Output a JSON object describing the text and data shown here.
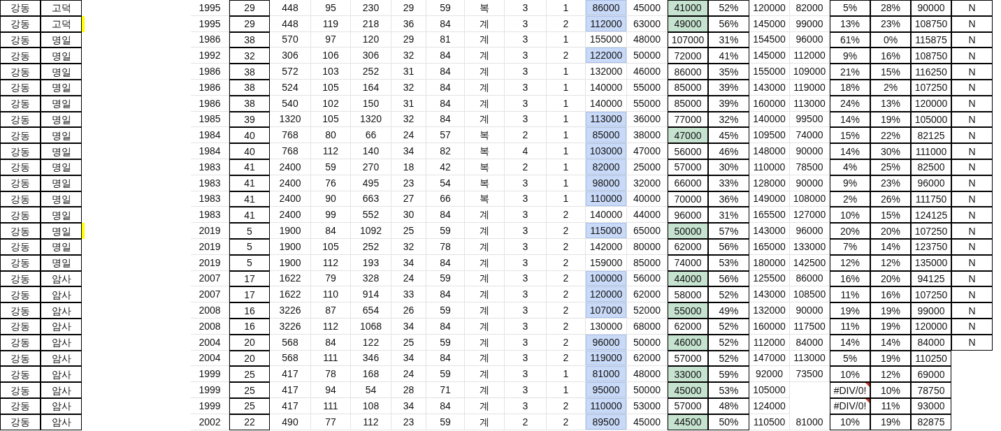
{
  "rows": [
    {
      "cells": [
        "강동",
        "고덕",
        "1995",
        "29",
        "448",
        "95",
        "230",
        "29",
        "59",
        "복",
        "3",
        "1",
        "86000",
        "45000",
        "41000",
        "52%",
        "120000",
        "82000",
        "5%",
        "28%",
        "90000",
        "N"
      ],
      "price_highlight": true,
      "gap_highlight": true,
      "marked": false,
      "error": false
    },
    {
      "cells": [
        "강동",
        "고덕",
        "1995",
        "29",
        "448",
        "119",
        "218",
        "36",
        "84",
        "계",
        "3",
        "2",
        "112000",
        "63000",
        "49000",
        "56%",
        "145000",
        "99000",
        "13%",
        "23%",
        "108750",
        "N"
      ],
      "price_highlight": true,
      "gap_highlight": true,
      "marked": true,
      "error": false
    },
    {
      "cells": [
        "강동",
        "명일",
        "1986",
        "38",
        "570",
        "97",
        "120",
        "29",
        "81",
        "계",
        "3",
        "1",
        "155000",
        "48000",
        "107000",
        "31%",
        "154500",
        "96000",
        "61%",
        "0%",
        "115875",
        "N"
      ],
      "price_highlight": false,
      "gap_highlight": false,
      "marked": false,
      "error": false
    },
    {
      "cells": [
        "강동",
        "명일",
        "1992",
        "32",
        "306",
        "106",
        "306",
        "32",
        "84",
        "계",
        "3",
        "2",
        "122000",
        "50000",
        "72000",
        "41%",
        "145000",
        "112000",
        "9%",
        "16%",
        "108750",
        "N"
      ],
      "price_highlight": true,
      "gap_highlight": false,
      "marked": false,
      "error": false
    },
    {
      "cells": [
        "강동",
        "명일",
        "1986",
        "38",
        "572",
        "103",
        "252",
        "31",
        "84",
        "계",
        "3",
        "1",
        "132000",
        "46000",
        "86000",
        "35%",
        "155000",
        "109000",
        "21%",
        "15%",
        "116250",
        "N"
      ],
      "price_highlight": false,
      "gap_highlight": false,
      "marked": false,
      "error": false
    },
    {
      "cells": [
        "강동",
        "명일",
        "1986",
        "38",
        "524",
        "105",
        "164",
        "32",
        "84",
        "계",
        "3",
        "1",
        "140000",
        "55000",
        "85000",
        "39%",
        "143000",
        "119000",
        "18%",
        "2%",
        "107250",
        "N"
      ],
      "price_highlight": false,
      "gap_highlight": false,
      "marked": false,
      "error": false
    },
    {
      "cells": [
        "강동",
        "명일",
        "1986",
        "38",
        "540",
        "102",
        "150",
        "31",
        "84",
        "계",
        "3",
        "1",
        "140000",
        "55000",
        "85000",
        "39%",
        "160000",
        "113000",
        "24%",
        "13%",
        "120000",
        "N"
      ],
      "price_highlight": false,
      "gap_highlight": false,
      "marked": false,
      "error": false
    },
    {
      "cells": [
        "강동",
        "명일",
        "1985",
        "39",
        "1320",
        "105",
        "1320",
        "32",
        "84",
        "계",
        "3",
        "1",
        "113000",
        "36000",
        "77000",
        "32%",
        "140000",
        "99500",
        "14%",
        "19%",
        "105000",
        "N"
      ],
      "price_highlight": true,
      "gap_highlight": false,
      "marked": false,
      "error": false
    },
    {
      "cells": [
        "강동",
        "명일",
        "1984",
        "40",
        "768",
        "80",
        "66",
        "24",
        "57",
        "복",
        "2",
        "1",
        "85000",
        "38000",
        "47000",
        "45%",
        "109500",
        "74000",
        "15%",
        "22%",
        "82125",
        "N"
      ],
      "price_highlight": true,
      "gap_highlight": true,
      "marked": false,
      "error": false
    },
    {
      "cells": [
        "강동",
        "명일",
        "1984",
        "40",
        "768",
        "112",
        "140",
        "34",
        "82",
        "복",
        "4",
        "1",
        "103000",
        "47000",
        "56000",
        "46%",
        "148000",
        "90000",
        "14%",
        "30%",
        "111000",
        "N"
      ],
      "price_highlight": true,
      "gap_highlight": false,
      "marked": false,
      "error": false
    },
    {
      "cells": [
        "강동",
        "명일",
        "1983",
        "41",
        "2400",
        "59",
        "270",
        "18",
        "42",
        "복",
        "2",
        "1",
        "82000",
        "25000",
        "57000",
        "30%",
        "110000",
        "78500",
        "4%",
        "25%",
        "82500",
        "N"
      ],
      "price_highlight": true,
      "gap_highlight": false,
      "marked": false,
      "error": false
    },
    {
      "cells": [
        "강동",
        "명일",
        "1983",
        "41",
        "2400",
        "76",
        "495",
        "23",
        "54",
        "복",
        "3",
        "1",
        "98000",
        "32000",
        "66000",
        "33%",
        "128000",
        "90000",
        "9%",
        "23%",
        "96000",
        "N"
      ],
      "price_highlight": true,
      "gap_highlight": false,
      "marked": false,
      "error": false
    },
    {
      "cells": [
        "강동",
        "명일",
        "1983",
        "41",
        "2400",
        "90",
        "663",
        "27",
        "66",
        "복",
        "3",
        "1",
        "110000",
        "40000",
        "70000",
        "36%",
        "149000",
        "108000",
        "2%",
        "26%",
        "111750",
        "N"
      ],
      "price_highlight": true,
      "gap_highlight": false,
      "marked": false,
      "error": false
    },
    {
      "cells": [
        "강동",
        "명일",
        "1983",
        "41",
        "2400",
        "99",
        "552",
        "30",
        "84",
        "계",
        "3",
        "2",
        "140000",
        "44000",
        "96000",
        "31%",
        "165500",
        "127000",
        "10%",
        "15%",
        "124125",
        "N"
      ],
      "price_highlight": false,
      "gap_highlight": false,
      "marked": false,
      "error": false
    },
    {
      "cells": [
        "강동",
        "명일",
        "2019",
        "5",
        "1900",
        "84",
        "1092",
        "25",
        "59",
        "계",
        "3",
        "2",
        "115000",
        "65000",
        "50000",
        "57%",
        "143000",
        "96000",
        "20%",
        "20%",
        "107250",
        "N"
      ],
      "price_highlight": true,
      "gap_highlight": true,
      "marked": true,
      "error": false
    },
    {
      "cells": [
        "강동",
        "명일",
        "2019",
        "5",
        "1900",
        "105",
        "252",
        "32",
        "78",
        "계",
        "3",
        "2",
        "142000",
        "80000",
        "62000",
        "56%",
        "165000",
        "133000",
        "7%",
        "14%",
        "123750",
        "N"
      ],
      "price_highlight": false,
      "gap_highlight": false,
      "marked": false,
      "error": false
    },
    {
      "cells": [
        "강동",
        "명일",
        "2019",
        "5",
        "1900",
        "112",
        "193",
        "34",
        "84",
        "계",
        "3",
        "2",
        "159000",
        "85000",
        "74000",
        "53%",
        "180000",
        "142500",
        "12%",
        "12%",
        "135000",
        "N"
      ],
      "price_highlight": false,
      "gap_highlight": false,
      "marked": false,
      "error": false
    },
    {
      "cells": [
        "강동",
        "암사",
        "2007",
        "17",
        "1622",
        "79",
        "328",
        "24",
        "59",
        "계",
        "3",
        "2",
        "100000",
        "56000",
        "44000",
        "56%",
        "125500",
        "86000",
        "16%",
        "20%",
        "94125",
        "N"
      ],
      "price_highlight": true,
      "gap_highlight": true,
      "marked": false,
      "error": false
    },
    {
      "cells": [
        "강동",
        "암사",
        "2007",
        "17",
        "1622",
        "110",
        "914",
        "33",
        "84",
        "계",
        "3",
        "2",
        "120000",
        "62000",
        "58000",
        "52%",
        "143000",
        "108500",
        "11%",
        "16%",
        "107250",
        "N"
      ],
      "price_highlight": true,
      "gap_highlight": false,
      "marked": false,
      "error": false
    },
    {
      "cells": [
        "강동",
        "암사",
        "2008",
        "16",
        "3226",
        "87",
        "654",
        "26",
        "59",
        "계",
        "3",
        "2",
        "107000",
        "52000",
        "55000",
        "49%",
        "132000",
        "90000",
        "19%",
        "19%",
        "99000",
        "N"
      ],
      "price_highlight": true,
      "gap_highlight": true,
      "marked": false,
      "error": false
    },
    {
      "cells": [
        "강동",
        "암사",
        "2008",
        "16",
        "3226",
        "112",
        "1068",
        "34",
        "84",
        "계",
        "3",
        "2",
        "130000",
        "68000",
        "62000",
        "52%",
        "160000",
        "117500",
        "11%",
        "19%",
        "120000",
        "N"
      ],
      "price_highlight": false,
      "gap_highlight": false,
      "marked": false,
      "error": false
    },
    {
      "cells": [
        "강동",
        "암사",
        "2004",
        "20",
        "568",
        "84",
        "122",
        "25",
        "59",
        "계",
        "3",
        "2",
        "96000",
        "50000",
        "46000",
        "52%",
        "112000",
        "84000",
        "14%",
        "14%",
        "84000",
        "N"
      ],
      "price_highlight": true,
      "gap_highlight": true,
      "marked": false,
      "error": false
    },
    {
      "cells": [
        "강동",
        "암사",
        "2004",
        "20",
        "568",
        "111",
        "346",
        "34",
        "84",
        "계",
        "3",
        "2",
        "119000",
        "62000",
        "57000",
        "52%",
        "147000",
        "113000",
        "5%",
        "19%",
        "110250",
        null
      ],
      "price_highlight": true,
      "gap_highlight": false,
      "marked": false,
      "error": false
    },
    {
      "cells": [
        "강동",
        "암사",
        "1999",
        "25",
        "417",
        "78",
        "168",
        "24",
        "59",
        "계",
        "3",
        "1",
        "81000",
        "48000",
        "33000",
        "59%",
        "92000",
        "73500",
        "10%",
        "12%",
        "69000",
        null
      ],
      "price_highlight": true,
      "gap_highlight": true,
      "marked": false,
      "error": false
    },
    {
      "cells": [
        "강동",
        "암사",
        "1999",
        "25",
        "417",
        "94",
        "54",
        "28",
        "71",
        "계",
        "3",
        "1",
        "95000",
        "50000",
        "45000",
        "53%",
        "105000",
        null,
        "#DIV/0!",
        "10%",
        "78750",
        null
      ],
      "price_highlight": true,
      "gap_highlight": true,
      "marked": false,
      "error": true
    },
    {
      "cells": [
        "강동",
        "암사",
        "1999",
        "25",
        "417",
        "111",
        "108",
        "34",
        "84",
        "계",
        "3",
        "2",
        "110000",
        "53000",
        "57000",
        "48%",
        "124000",
        null,
        "#DIV/0!",
        "11%",
        "93000",
        null
      ],
      "price_highlight": true,
      "gap_highlight": false,
      "marked": false,
      "error": true
    },
    {
      "cells": [
        "강동",
        "암사",
        "2002",
        "22",
        "490",
        "77",
        "112",
        "23",
        "59",
        "계",
        "2",
        "2",
        "89500",
        "45000",
        "44500",
        "50%",
        "110500",
        "81000",
        "10%",
        "19%",
        "82875",
        null
      ],
      "price_highlight": true,
      "gap_highlight": true,
      "marked": false,
      "error": false
    }
  ]
}
